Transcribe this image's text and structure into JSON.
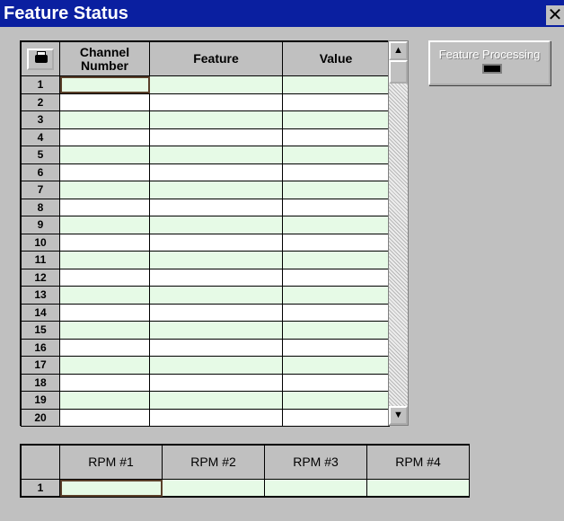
{
  "window": {
    "title": "Feature Status",
    "close_glyph": "✕"
  },
  "grid": {
    "print_icon": "printer-icon",
    "columns": [
      "Channel\nNumber",
      "Feature",
      "Value"
    ],
    "rows": [
      {
        "num": "1",
        "channel": "",
        "feature": "",
        "value": ""
      },
      {
        "num": "2",
        "channel": "",
        "feature": "",
        "value": ""
      },
      {
        "num": "3",
        "channel": "",
        "feature": "",
        "value": ""
      },
      {
        "num": "4",
        "channel": "",
        "feature": "",
        "value": ""
      },
      {
        "num": "5",
        "channel": "",
        "feature": "",
        "value": ""
      },
      {
        "num": "6",
        "channel": "",
        "feature": "",
        "value": ""
      },
      {
        "num": "7",
        "channel": "",
        "feature": "",
        "value": ""
      },
      {
        "num": "8",
        "channel": "",
        "feature": "",
        "value": ""
      },
      {
        "num": "9",
        "channel": "",
        "feature": "",
        "value": ""
      },
      {
        "num": "10",
        "channel": "",
        "feature": "",
        "value": ""
      },
      {
        "num": "11",
        "channel": "",
        "feature": "",
        "value": ""
      },
      {
        "num": "12",
        "channel": "",
        "feature": "",
        "value": ""
      },
      {
        "num": "13",
        "channel": "",
        "feature": "",
        "value": ""
      },
      {
        "num": "14",
        "channel": "",
        "feature": "",
        "value": ""
      },
      {
        "num": "15",
        "channel": "",
        "feature": "",
        "value": ""
      },
      {
        "num": "16",
        "channel": "",
        "feature": "",
        "value": ""
      },
      {
        "num": "17",
        "channel": "",
        "feature": "",
        "value": ""
      },
      {
        "num": "18",
        "channel": "",
        "feature": "",
        "value": ""
      },
      {
        "num": "19",
        "channel": "",
        "feature": "",
        "value": ""
      },
      {
        "num": "20",
        "channel": "",
        "feature": "",
        "value": ""
      }
    ]
  },
  "scrollbar": {
    "up_glyph": "▲",
    "down_glyph": "▼"
  },
  "feature_processing": {
    "label": "Feature Processing",
    "indicator_color": "#000000"
  },
  "rpm": {
    "columns": [
      "RPM #1",
      "RPM #2",
      "RPM #3",
      "RPM #4"
    ],
    "rows": [
      {
        "num": "1",
        "values": [
          "",
          "",
          "",
          ""
        ]
      }
    ]
  },
  "colors": {
    "titlebar": "#0a1fa0",
    "row_green": "#e6fae6",
    "face": "#c0c0c0"
  }
}
